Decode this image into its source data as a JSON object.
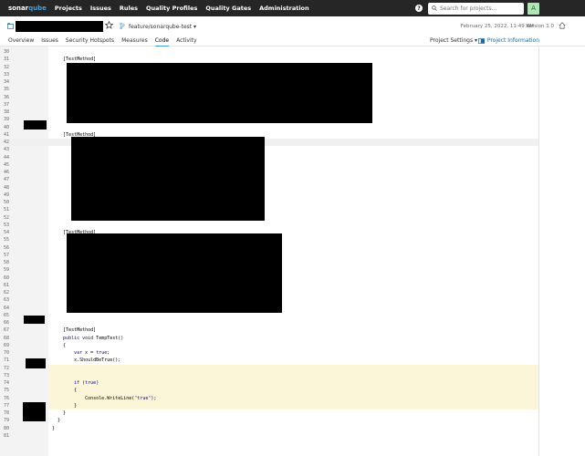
{
  "nav": {
    "logo_main": "sonar",
    "logo_accent": "qube",
    "links": [
      "Projects",
      "Issues",
      "Rules",
      "Quality Profiles",
      "Quality Gates",
      "Administration"
    ],
    "help": "?",
    "search_placeholder": "Search for projects...",
    "avatar_initial": "A"
  },
  "project": {
    "branch": "feature/sonarqube-test",
    "branch_caret": "▾",
    "analysis_date": "February 25, 2022, 11:49 AM",
    "version": "Version 1.0",
    "tabs": [
      "Overview",
      "Issues",
      "Security Hotspots",
      "Measures",
      "Code",
      "Activity"
    ],
    "active_tab": "Code",
    "settings_label": "Project Settings ▾",
    "info_label": "Project Information"
  },
  "code": {
    "lines": [
      {
        "n": "30",
        "t": ""
      },
      {
        "n": "31",
        "t": "    [TestMethod]",
        "cls": "attr"
      },
      {
        "n": "32",
        "t": ""
      },
      {
        "n": "33",
        "t": ""
      },
      {
        "n": "34",
        "t": ""
      },
      {
        "n": "35",
        "t": ""
      },
      {
        "n": "36",
        "t": ""
      },
      {
        "n": "37",
        "t": ""
      },
      {
        "n": "38",
        "t": ""
      },
      {
        "n": "39",
        "t": ""
      },
      {
        "n": "40",
        "t": ""
      },
      {
        "n": "41",
        "t": "    [TestMethod]",
        "cls": "attr"
      },
      {
        "n": "42",
        "t": ""
      },
      {
        "n": "43",
        "t": ""
      },
      {
        "n": "44",
        "t": ""
      },
      {
        "n": "45",
        "t": "                                                  );"
      },
      {
        "n": "46",
        "t": ""
      },
      {
        "n": "47",
        "t": ""
      },
      {
        "n": "48",
        "t": ""
      },
      {
        "n": "49",
        "t": ""
      },
      {
        "n": "50",
        "t": ""
      },
      {
        "n": "51",
        "t": ""
      },
      {
        "n": "52",
        "t": ""
      },
      {
        "n": "53",
        "t": ""
      },
      {
        "n": "54",
        "t": "    [TestMethod]",
        "cls": "attr"
      },
      {
        "n": "55",
        "t": ""
      },
      {
        "n": "56",
        "t": ""
      },
      {
        "n": "57",
        "t": ""
      },
      {
        "n": "58",
        "t": ""
      },
      {
        "n": "59",
        "t": ""
      },
      {
        "n": "60",
        "t": ""
      },
      {
        "n": "61",
        "t": ""
      },
      {
        "n": "62",
        "t": ""
      },
      {
        "n": "63",
        "t": ""
      },
      {
        "n": "64",
        "t": ""
      },
      {
        "n": "65",
        "t": ""
      },
      {
        "n": "66",
        "t": ""
      },
      {
        "n": "67",
        "t": "    [TestMethod]",
        "cls": "attr"
      },
      {
        "n": "68",
        "t": "    public void TempTest()"
      },
      {
        "n": "69",
        "t": "    {"
      },
      {
        "n": "70",
        "t": "        var x = true;"
      },
      {
        "n": "71",
        "t": "        x.ShouldBeTrue();"
      },
      {
        "n": "72",
        "t": ""
      },
      {
        "n": "73",
        "t": ""
      },
      {
        "n": "74",
        "t": "        if (true)"
      },
      {
        "n": "75",
        "t": "        {"
      },
      {
        "n": "76",
        "t": "            Console.WriteLine(\"true\");"
      },
      {
        "n": "77",
        "t": "        }"
      },
      {
        "n": "78",
        "t": "    }"
      },
      {
        "n": "79",
        "t": "  }"
      },
      {
        "n": "80",
        "t": "}"
      },
      {
        "n": "81",
        "t": ""
      }
    ]
  },
  "colors": {
    "nav_bg": "#262626",
    "accent": "#4b9fd5",
    "highlight_yellow": "#fcf6d9",
    "gutter": "#f3f3f3"
  }
}
